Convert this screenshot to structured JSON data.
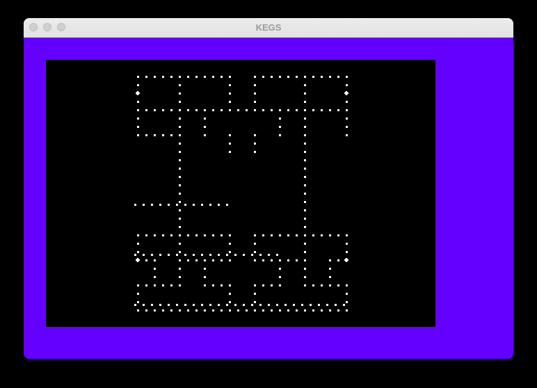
{
  "window": {
    "title": "KEGS",
    "controls": [
      "close-button",
      "minimize-button",
      "zoom-button"
    ]
  },
  "colors": {
    "border": "#6400FF",
    "screen": "#000000",
    "dots": "#FFFFFF",
    "titlebar": "#E6E6E6",
    "title_text": "#9A9A9A"
  },
  "game": {
    "maze_style": "dotted-lines",
    "power_pellets": 4
  }
}
